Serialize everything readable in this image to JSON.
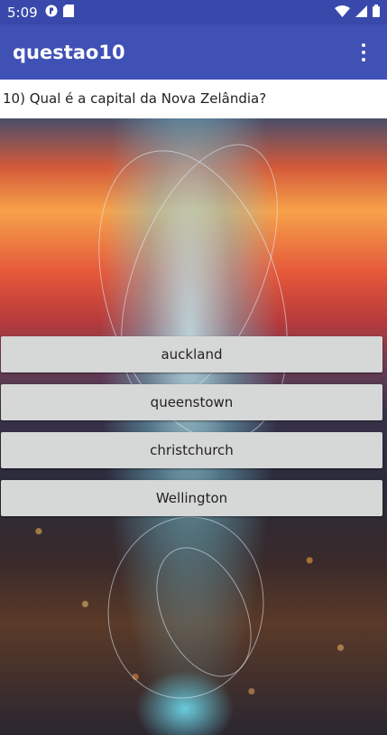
{
  "status_bar": {
    "time": "5:09",
    "left_icons": [
      "app-notification-icon",
      "sd-card-icon"
    ],
    "right_icons": [
      "wifi-icon",
      "signal-icon",
      "battery-icon"
    ]
  },
  "app_bar": {
    "title": "questao10",
    "menu_icon": "overflow-menu-icon"
  },
  "question": {
    "text": "10) Qual é a capital da Nova Zelândia?"
  },
  "answers": [
    {
      "label": "auckland"
    },
    {
      "label": "queenstown"
    },
    {
      "label": "christchurch"
    },
    {
      "label": "Wellington"
    }
  ],
  "colors": {
    "status_bar": "#3949ab",
    "app_bar": "#3f51b5",
    "button": "#d6d7d7"
  }
}
